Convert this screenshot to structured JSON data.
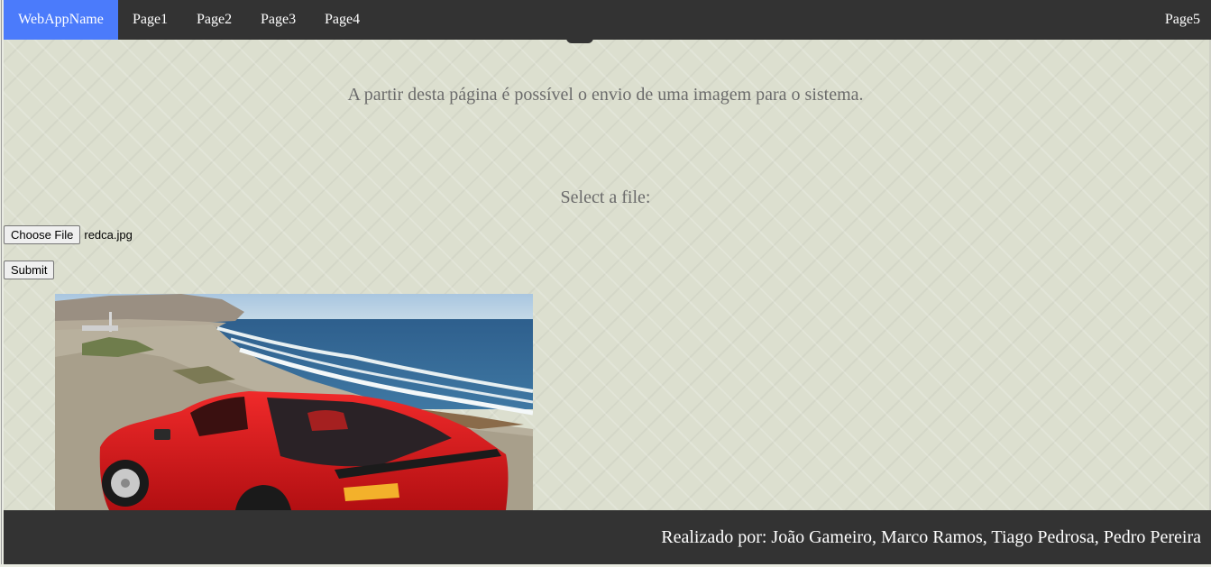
{
  "navbar": {
    "brand": "WebAppName",
    "links": [
      "Page1",
      "Page2",
      "Page3",
      "Page4"
    ],
    "right_link": "Page5"
  },
  "main": {
    "intro_text": "A partir desta página é possível o envio de uma imagem para o sistema.",
    "select_label": "Select a file:",
    "file_input": {
      "button_label": "Choose File",
      "file_name": "redca.jpg"
    },
    "submit_label": "Submit"
  },
  "footer": {
    "text": "Realizado por: João Gameiro, Marco Ramos, Tiago Pedrosa, Pedro Pereira"
  },
  "colors": {
    "navbar_bg": "#333333",
    "brand_bg": "#4b7bfb",
    "page_bg": "#dcdfcf",
    "text_gray": "#6b6b6b",
    "footer_bg": "#333333"
  }
}
